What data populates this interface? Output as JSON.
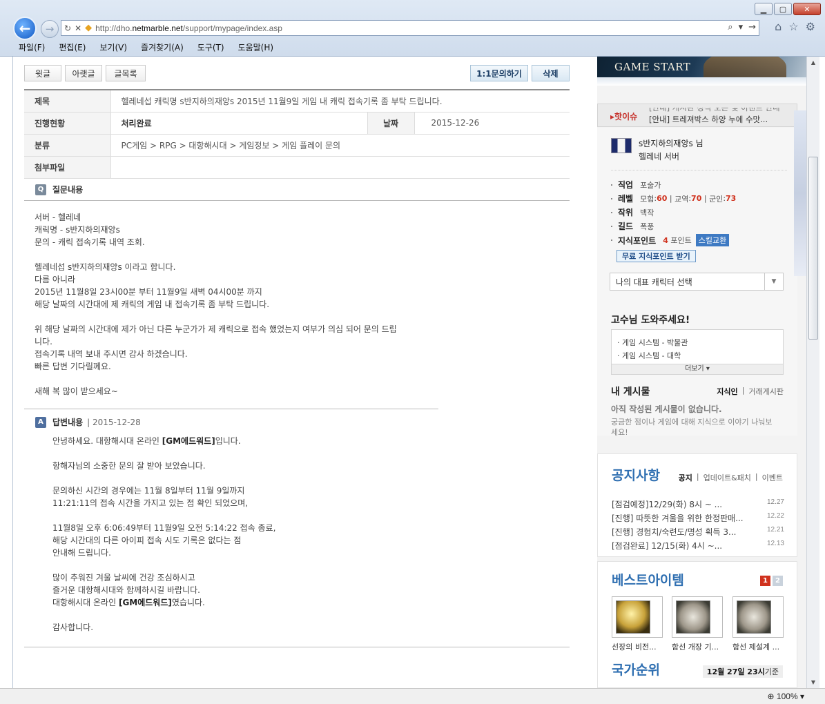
{
  "browser": {
    "url_prefix": "http://dho.",
    "url_domain": "netmarble.net",
    "url_path": "/support/mypage/index.asp",
    "menu": [
      "파일(F)",
      "편집(E)",
      "보기(V)",
      "즐겨찾기(A)",
      "도구(T)",
      "도움말(H)"
    ],
    "zoom": "100%"
  },
  "toolbar": {
    "prev_label": "윗글",
    "next_label": "아랫글",
    "list_label": "글목록",
    "inquiry_label": "1:1문의하기",
    "delete_label": "삭제"
  },
  "info": {
    "title_label": "제목",
    "title_value": "헬레네섭 캐릭명 s반지하의재앙s 2015년 11월9일 게임 내 캐릭 접속기록 좀 부탁 드립니다.",
    "status_label": "진행현황",
    "status_value": "처리완료",
    "date_label": "날짜",
    "date_value": "2015-12-26",
    "category_label": "분류",
    "category_value": "PC게임 > RPG > 대항해시대  > 게임정보 > 게임 플레이 문의",
    "attach_label": "첨부파일"
  },
  "question": {
    "badge": "Q",
    "heading": "질문내용",
    "lines": [
      "서버 - 헬레네",
      "캐릭명 - s반지하의재앙s",
      "문의 - 캐릭 접속기록 내역 조회.",
      "",
      "헬레네섭 s반지하의재앙s 이라고 합니다.",
      "다름 아니라",
      "2015년 11월8일 23시00분 부터 11월9일 새벽 04시00분 까지",
      "해당 날짜의 시간대에 제 캐릭의 게임 내 접속기록 좀 부탁 드립니다.",
      "",
      "위 해당 날짜의 시간대에 제가 아닌 다른 누군가가 제 캐릭으로 접속 했었는지 여부가 의심 되어 문의 드립",
      "니다.",
      "접속기록 내역 보내 주시면 감사 하겠습니다.",
      "빠른 답변 기다릴께요.",
      "",
      "새해 복 많이 받으세요~"
    ]
  },
  "answer": {
    "badge": "A",
    "heading": "답변내용",
    "date": "2015-12-28",
    "greet_pre": "안녕하세요. 대항해시대 온라인 ",
    "gm_name": "[GM에드워드]",
    "greet_post": "입니다.",
    "lines_mid": [
      "",
      "항해자님의 소중한 문의 잘 받아 보았습니다.",
      "",
      "문의하신 시간의 경우에는 11월 8일부터 11월 9일까지",
      "11:21:11의 접속 시간을 가지고 있는 점 확인 되었으며,",
      "",
      "11월8일 오후 6:06:49부터 11월9일 오전 5:14:22 접속 종료,",
      "해당 시간대의 다른 아이피 접속 시도 기록은 없다는 점",
      "안내해 드립니다.",
      "",
      "많이 추워진 겨울 날씨에 건강 조심하시고",
      "즐거운 대항해시대와 함께하시길 바랍니다."
    ],
    "sign_pre": "대항해시대 온라인 ",
    "sign_post": "였습니다.",
    "closing": "감사합니다."
  },
  "sidebar": {
    "banner": "GAME START",
    "hot_label": "핫이슈",
    "hot_text": "[안내] 트레져박스 하양 누에 수맛...",
    "hot_text_prev": "[안내] 게시판 정식 오픈 및 이벤트 안내",
    "profile": {
      "name": "s반지하의재앙s",
      "name_suffix": "님",
      "server": "헬레네 서버",
      "job_label": "직업",
      "job": "포술가",
      "level_label": "레벨",
      "level_adv_label": "모험",
      "level_adv": "60",
      "level_trade_label": "교역",
      "level_trade": "70",
      "level_mil_label": "군인",
      "level_mil": "73",
      "rank_label": "작위",
      "rank": "백작",
      "guild_label": "길드",
      "guild": "폭풍",
      "kp_label": "지식포인트",
      "kp_value": "4",
      "kp_unit": "포인트",
      "skill_exchange": "스킬교환",
      "free_point": "무료 지식포인트 받기",
      "char_select": "나의 대표 캐릭터 선택"
    },
    "help": {
      "title": "고수님 도와주세요!",
      "items": [
        "게임 시스템 - 박물관",
        "게임 시스템 - 대학"
      ],
      "more": "더보기 ▾"
    },
    "mypost": {
      "title": "내 게시물",
      "tab_on": "지식인",
      "tab_off": "거래게시판",
      "empty": "아직 작성된 게시물이 없습니다.",
      "desc": "궁금한 점이나 게임에 대해 지식으로 이야기 나눠보세요!"
    },
    "notice": {
      "title": "공지사항",
      "tab_on": "공지",
      "tab_update": "업데이트&패치",
      "tab_event": "이벤트",
      "rows": [
        {
          "text": "[점검예정]12/29(화) 8시 ~ ...",
          "date": "12.27"
        },
        {
          "text": "[진행] 따뜻한 겨울을 위한 한정판매...",
          "date": "12.22"
        },
        {
          "text": "[진행] 경험치/숙련도/명성 획득 3...",
          "date": "12.21"
        },
        {
          "text": "[점검완료] 12/15(화) 4시 ~...",
          "date": "12.13"
        }
      ]
    },
    "best": {
      "title": "베스트아이템",
      "page1": "1",
      "page2": "2",
      "items": [
        "선장의 비전...",
        "함선 개장 기...",
        "함선 제설계 ..."
      ]
    },
    "rank": {
      "title": "국가순위",
      "stamp_date": "12월 27일 23시",
      "stamp_suffix": " 기준"
    }
  },
  "colors": {
    "accent_blue": "#2f6fb1",
    "hot_red": "#c6302a",
    "level_red": "#d0321e"
  }
}
